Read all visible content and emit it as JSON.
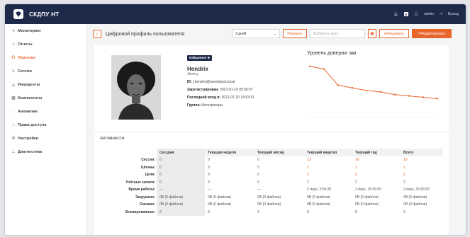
{
  "app": {
    "name": "СКДПУ НТ"
  },
  "topbar": {
    "user": "admin",
    "logout": "Выход",
    "badge": "9"
  },
  "sidebar": {
    "items": [
      {
        "label": "Мониторинг",
        "icon": "pulse-icon"
      },
      {
        "label": "Отчеты",
        "icon": "reports-icon"
      },
      {
        "label": "Персоны",
        "icon": "persons-icon"
      },
      {
        "label": "Сессии",
        "icon": "sessions-icon"
      },
      {
        "label": "Инциденты",
        "icon": "incidents-icon"
      },
      {
        "label": "Компоненты",
        "icon": "components-icon"
      },
      {
        "label": "Аномалии",
        "icon": "anomalies-icon"
      },
      {
        "label": "Права доступа",
        "icon": "access-rights-icon"
      },
      {
        "label": "Настройки",
        "icon": "settings-icon"
      },
      {
        "label": "Диагностика",
        "icon": "diagnostics-icon"
      }
    ]
  },
  "toolbar": {
    "back": "‹",
    "title": "Цифровой профиль пользователя",
    "period": "3 дней",
    "show": "Показать",
    "date_placeholder": "Выберите дату",
    "notify": "Уведомить",
    "edit": "Редактировать"
  },
  "profile": {
    "tag": "Избранное",
    "last_name": "Hendrix",
    "first_name": "Jimmy",
    "id_label": "ID:",
    "id_value": "j.hendrix@woodstock.local",
    "registered_label": "Зарегистрирован:",
    "registered_value": "2021-01-19 05:56:07",
    "lastlogin_label": "Последний вход в:",
    "lastlogin_value": "2021-07-20 14:53:31",
    "group_label": "Группа:",
    "group_value": "Интеграторы"
  },
  "trust": {
    "label": "Уровень доверия:",
    "value": "560"
  },
  "trust_chart": {
    "type": "line",
    "values": [
      98,
      96,
      84,
      82,
      80,
      79,
      77,
      76,
      75,
      74
    ],
    "ylim": [
      60,
      100
    ],
    "color": "#e8662b"
  },
  "activity": {
    "title": "Активности",
    "columns": [
      "Сегодня",
      "Текущая неделя",
      "Текущий месяц",
      "Текущий квартал",
      "Текущий год",
      "Всего"
    ],
    "rows": [
      {
        "label": "Сессии:",
        "values": [
          "0",
          "0",
          "0",
          "13",
          "16",
          "16"
        ],
        "highlight": [
          false,
          false,
          false,
          true,
          true,
          true
        ]
      },
      {
        "label": "Шпоны:",
        "values": [
          "0",
          "0",
          "0",
          "1",
          "1",
          "1"
        ],
        "highlight": [
          false,
          false,
          false,
          true,
          true,
          true
        ]
      },
      {
        "label": "Цели:",
        "values": [
          "0",
          "0",
          "0",
          "2",
          "2",
          "2"
        ],
        "highlight": [
          false,
          false,
          false,
          true,
          true,
          true
        ]
      },
      {
        "label": "Учётные записи:",
        "values": [
          "0",
          "0",
          "0",
          "2",
          "2",
          "2"
        ],
        "highlight": [
          false,
          false,
          false,
          false,
          false,
          false
        ]
      },
      {
        "label": "Время работы:",
        "values": [
          "—",
          "—",
          "—",
          "2 days, 3:56:28",
          "2 days, 15:56:50",
          "2 days, 15:56:50"
        ],
        "highlight": [
          false,
          false,
          false,
          false,
          false,
          false
        ]
      },
      {
        "label": "Загружено:",
        "values": [
          "0B (0 файлов)",
          "0B (0 файлов)",
          "0B (0 файлов)",
          "0B (0 файлов)",
          "0B (0 файлов)",
          "0B (0 файлов)"
        ],
        "highlight": [
          false,
          false,
          false,
          false,
          false,
          false
        ]
      },
      {
        "label": "Скачано:",
        "values": [
          "0B (0 файлов)",
          "0B (0 файлов)",
          "0B (0 файлов)",
          "0B (0 файлов)",
          "0B (0 файлов)",
          "0B (0 файлов)"
        ],
        "highlight": [
          false,
          false,
          false,
          false,
          false,
          false
        ]
      },
      {
        "label": "Блокированные:",
        "values": [
          "0",
          "0",
          "0",
          "0",
          "0",
          "0"
        ],
        "highlight": [
          false,
          false,
          false,
          false,
          false,
          false
        ]
      }
    ]
  }
}
